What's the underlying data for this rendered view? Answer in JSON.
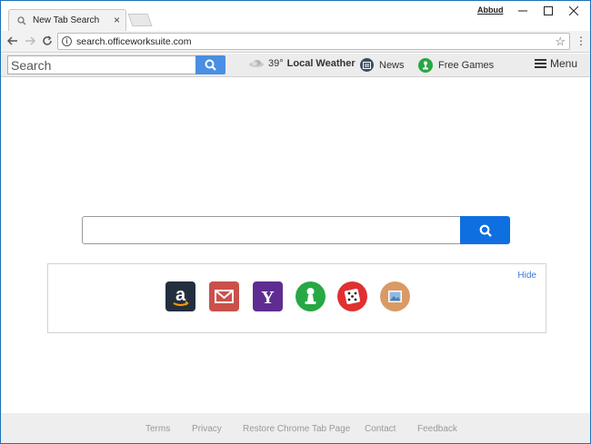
{
  "browser": {
    "tab_title": "New Tab Search",
    "tab_close": "×",
    "profile_name": "Abbud",
    "url": "search.officeworksuite.com"
  },
  "toolbar": {
    "search_placeholder": "Search",
    "weather_temp": "39°",
    "weather_label": "Local Weather",
    "news_label": "News",
    "games_label": "Free Games",
    "menu_label": "Menu"
  },
  "main": {
    "search_placeholder": ""
  },
  "quicklinks": {
    "hide_label": "Hide",
    "items": [
      {
        "name": "amazon",
        "icon": "amazon-icon",
        "color": "#232f3e"
      },
      {
        "name": "gmail",
        "icon": "mail-icon",
        "color": "#c9514a"
      },
      {
        "name": "yahoo",
        "icon": "yahoo-icon",
        "color": "#5f2d91",
        "glyph": "Y"
      },
      {
        "name": "games",
        "icon": "games-icon",
        "color": "#27a844"
      },
      {
        "name": "dice",
        "icon": "dice-icon",
        "color": "#e03131"
      },
      {
        "name": "photos",
        "icon": "photo-icon",
        "color": "#d99a66"
      }
    ]
  },
  "footer": {
    "links": [
      "Terms",
      "Privacy",
      "Restore Chrome Tab Page",
      "Contact",
      "Feedback"
    ]
  },
  "colors": {
    "accent_blue": "#0e6fe0",
    "toolbar_button_blue": "#4a8fe3",
    "window_border": "#1e6fb8"
  }
}
